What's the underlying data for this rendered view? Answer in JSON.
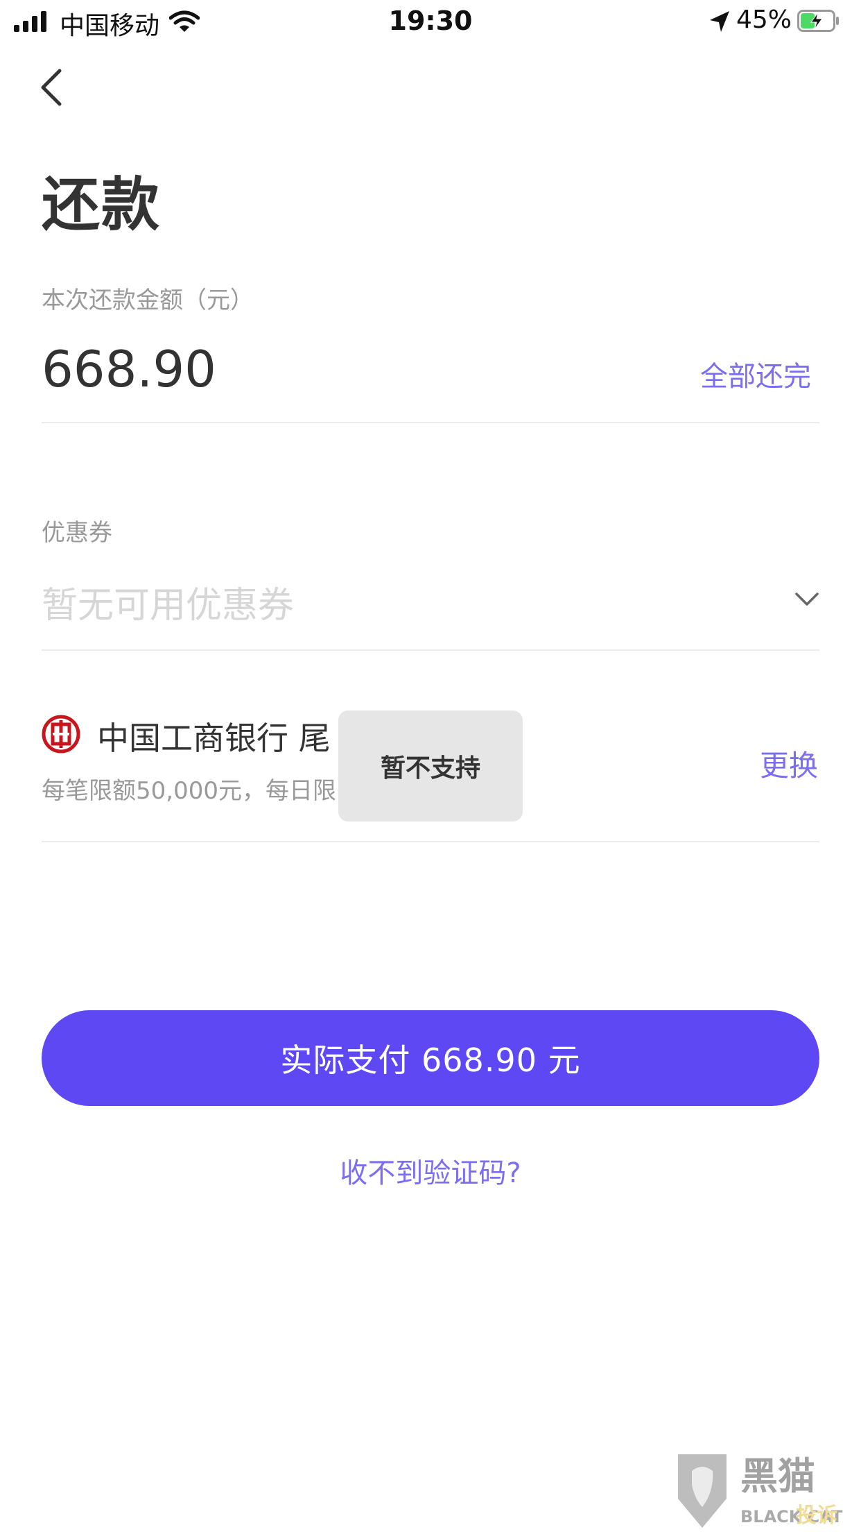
{
  "status_bar": {
    "carrier": "中国移动",
    "time": "19:30",
    "battery_percent": "45%",
    "battery_level": 0.45,
    "icons": [
      "signal-icon",
      "wifi-icon",
      "location-arrow-icon",
      "battery-charging-icon"
    ]
  },
  "nav": {
    "back_icon": "chevron-left-icon"
  },
  "page": {
    "title": "还款"
  },
  "amount": {
    "label": "本次还款金额（元）",
    "value": "668.90",
    "pay_all_label": "全部还完"
  },
  "coupon": {
    "label": "优惠券",
    "value": "暂无可用优惠券",
    "icon": "chevron-down-icon"
  },
  "bank": {
    "logo_icon": "icbc-logo-icon",
    "name": "中国工商银行  尾",
    "limit_text": "每笔限额50,000元，每日限",
    "change_label": "更换"
  },
  "toast": {
    "text": "暂不支持"
  },
  "pay_button": {
    "label": "实际支付 668.90 元"
  },
  "sms_link": {
    "label": "收不到验证码?"
  },
  "colors": {
    "accent": "#5d48f4",
    "link": "#7b6ef0",
    "muted_text": "#999999",
    "divider": "#ececec",
    "bank_logo_red": "#c7161d"
  },
  "watermark": {
    "brand": "黑猫",
    "sub": "BLACK CAT",
    "tag": "投诉"
  }
}
